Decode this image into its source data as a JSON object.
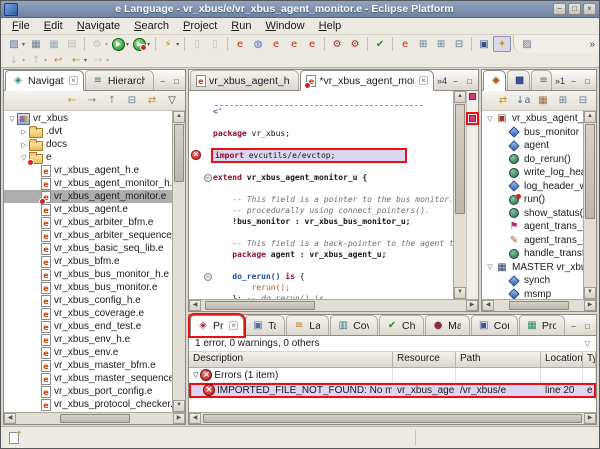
{
  "window": {
    "title": "e Language - vr_xbus/e/vr_xbus_agent_monitor.e - Eclipse Platform",
    "controls": [
      "minimize",
      "maximize",
      "close"
    ]
  },
  "menu": {
    "items": [
      "File",
      "Edit",
      "Navigate",
      "Search",
      "Project",
      "Run",
      "Window",
      "Help"
    ]
  },
  "toolbar": {
    "overflow": "»",
    "row1": [
      {
        "icon": "new-wizard",
        "dd": true
      },
      {
        "icon": "save"
      },
      {
        "icon": "save-all"
      },
      {
        "icon": "print",
        "disabled": true
      },
      {
        "sep": true
      },
      {
        "icon": "build",
        "dd": true,
        "disabled": true
      },
      {
        "icon": "run",
        "dd": true
      },
      {
        "icon": "run-external",
        "dd": true
      },
      {
        "sep": true
      },
      {
        "icon": "search-torch",
        "dd": true
      },
      {
        "sep": true
      },
      {
        "icon": "mark-occurrences",
        "disabled": true
      },
      {
        "icon": "mark-declarations",
        "disabled": true
      },
      {
        "sep": true
      },
      {
        "icon": "e-module"
      },
      {
        "icon": "e-globe"
      },
      {
        "icon": "e-file-new"
      },
      {
        "icon": "e-file-import"
      },
      {
        "icon": "e-file-export"
      },
      {
        "sep": true
      },
      {
        "icon": "compile-gears"
      },
      {
        "icon": "recompile-gears"
      },
      {
        "sep": true
      },
      {
        "icon": "e-check"
      },
      {
        "sep": true
      },
      {
        "icon": "e-doc"
      },
      {
        "icon": "expand-one"
      },
      {
        "icon": "expand-all-box"
      },
      {
        "icon": "collapse-all-box"
      },
      {
        "sep": true
      },
      {
        "icon": "cubes"
      },
      {
        "icon": "flashlight",
        "pressed": true
      }
    ],
    "row2": [
      {
        "icon": "next-annotation",
        "dd": true,
        "disabled": true
      },
      {
        "icon": "prev-annotation",
        "dd": true,
        "disabled": true
      },
      {
        "icon": "last-edit-location"
      },
      {
        "icon": "back",
        "dd": true
      },
      {
        "icon": "forward",
        "dd": true,
        "disabled": true
      }
    ],
    "perspective": {
      "icon": "perspective"
    }
  },
  "navigator": {
    "tabs": [
      {
        "label": "Navigator",
        "icon": "navigator",
        "active": true,
        "close": true
      },
      {
        "label": "Hierarchy",
        "icon": "hierarchy"
      }
    ],
    "tools": [
      "back",
      "forward",
      "up",
      "collapse-all-box",
      "link-editor",
      "view-menu"
    ],
    "tree": [
      {
        "depth": 0,
        "exp": "open",
        "icon": "project",
        "label": "vr_xbus"
      },
      {
        "depth": 1,
        "exp": "closed",
        "icon": "folder",
        "label": ".dvt"
      },
      {
        "depth": 1,
        "exp": "closed",
        "icon": "folder",
        "label": "docs"
      },
      {
        "depth": 1,
        "exp": "open",
        "icon": "folder-err",
        "label": "e"
      },
      {
        "depth": 2,
        "icon": "efile",
        "label": "vr_xbus_agent_h.e"
      },
      {
        "depth": 2,
        "icon": "efile",
        "label": "vr_xbus_agent_monitor_h.e"
      },
      {
        "depth": 2,
        "icon": "efile-err",
        "label": "vr_xbus_agent_monitor.e",
        "sel": true
      },
      {
        "depth": 2,
        "icon": "efile",
        "label": "vr_xbus_agent.e"
      },
      {
        "depth": 2,
        "icon": "efile",
        "label": "vr_xbus_arbiter_bfm.e"
      },
      {
        "depth": 2,
        "icon": "efile",
        "label": "vr_xbus_arbiter_sequence_h.e"
      },
      {
        "depth": 2,
        "icon": "efile",
        "label": "vr_xbus_basic_seq_lib.e"
      },
      {
        "depth": 2,
        "icon": "efile",
        "label": "vr_xbus_bfm.e"
      },
      {
        "depth": 2,
        "icon": "efile",
        "label": "vr_xbus_bus_monitor_h.e"
      },
      {
        "depth": 2,
        "icon": "efile",
        "label": "vr_xbus_bus_monitor.e"
      },
      {
        "depth": 2,
        "icon": "efile",
        "label": "vr_xbus_config_h.e"
      },
      {
        "depth": 2,
        "icon": "efile",
        "label": "vr_xbus_coverage.e"
      },
      {
        "depth": 2,
        "icon": "efile",
        "label": "vr_xbus_end_test.e"
      },
      {
        "depth": 2,
        "icon": "efile",
        "label": "vr_xbus_env_h.e"
      },
      {
        "depth": 2,
        "icon": "efile",
        "label": "vr_xbus_env.e"
      },
      {
        "depth": 2,
        "icon": "efile",
        "label": "vr_xbus_master_bfm.e"
      },
      {
        "depth": 2,
        "icon": "efile",
        "label": "vr_xbus_master_sequence_h.e"
      },
      {
        "depth": 2,
        "icon": "efile",
        "label": "vr_xbus_port_config.e"
      },
      {
        "depth": 2,
        "icon": "efile",
        "label": "vr_xbus_protocol_checker.e"
      }
    ]
  },
  "editor": {
    "tabs": [
      {
        "label": "vr_xbus_agent_h.e",
        "icon": "efile"
      },
      {
        "label": "*vr_xbus_agent_monit",
        "icon": "efile-err",
        "active": true,
        "close": true
      }
    ],
    "overflow": "»4",
    "code": [
      {
        "dashed": true
      },
      {
        "seg": [
          {
            "t": "<'",
            "c": "hd"
          }
        ]
      },
      {
        "seg": []
      },
      {
        "seg": [
          {
            "t": "package ",
            "c": "k"
          },
          {
            "t": "vr_xbus;",
            "c": "p"
          }
        ]
      },
      {
        "seg": []
      },
      {
        "err": true,
        "errIcon": true,
        "seg": [
          {
            "t": "import ",
            "c": "k"
          },
          {
            "t": "evcutils/e/evctop;",
            "c": "p"
          }
        ]
      },
      {
        "seg": []
      },
      {
        "fold": true,
        "seg": [
          {
            "t": "extend ",
            "c": "k"
          },
          {
            "t": "vr_xbus_agent_monitor_u {",
            "c": "b"
          }
        ]
      },
      {
        "seg": []
      },
      {
        "seg": [
          {
            "t": "    -- This field is a pointer to the bus monitor. Note",
            "c": "c"
          }
        ]
      },
      {
        "seg": [
          {
            "t": "    -- procedurally using connect_pointers().",
            "c": "c"
          }
        ]
      },
      {
        "seg": [
          {
            "t": "    !bus_monitor : vr_xbus_bus_monitor_u;",
            "c": "b"
          }
        ]
      },
      {
        "seg": []
      },
      {
        "seg": [
          {
            "t": "    -- This field is a back-pointer to the agent this mo",
            "c": "c"
          }
        ]
      },
      {
        "seg": [
          {
            "t": "    ",
            "c": "p"
          },
          {
            "t": "package ",
            "c": "k"
          },
          {
            "t": "agent : vr_xbus_agent_u;",
            "c": "b"
          }
        ]
      },
      {
        "seg": []
      },
      {
        "fold": true,
        "seg": [
          {
            "t": "    ",
            "c": "p"
          },
          {
            "t": "do_rerun()",
            "c": "m"
          },
          {
            "t": " ",
            "c": "p"
          },
          {
            "t": "is",
            "c": "k"
          },
          {
            "t": " {",
            "c": "p"
          }
        ]
      },
      {
        "seg": [
          {
            "t": "        ",
            "c": "p"
          },
          {
            "t": "rerun();",
            "c": "f"
          }
        ]
      },
      {
        "seg": [
          {
            "t": "    }; ",
            "c": "p"
          },
          {
            "t": "-- do_rerun() is",
            "c": "c"
          }
        ]
      }
    ]
  },
  "outline": {
    "tabs": [
      {
        "label": "L",
        "icon": "outline-l",
        "active": true
      },
      {
        "label": "T",
        "icon": "outline-t"
      },
      {
        "label": "I",
        "icon": "outline-i"
      }
    ],
    "overflow": "»1",
    "tools": [
      "link-editor",
      "sort-az",
      "filter-grid",
      "expand-all-box",
      "collapse-all-box"
    ],
    "tree": [
      {
        "depth": 0,
        "exp": "open",
        "icon": "module",
        "label": "vr_xbus_agent_mo"
      },
      {
        "depth": 1,
        "icon": "field",
        "label": "bus_monitor"
      },
      {
        "depth": 1,
        "icon": "field",
        "label": "agent"
      },
      {
        "depth": 1,
        "icon": "method",
        "label": "do_rerun()"
      },
      {
        "depth": 1,
        "icon": "method",
        "label": "write_log_heade"
      },
      {
        "depth": 1,
        "icon": "field",
        "label": "log_header_writt"
      },
      {
        "depth": 1,
        "icon": "method-o",
        "label": "run()"
      },
      {
        "depth": 1,
        "icon": "method",
        "label": "show_status()"
      },
      {
        "depth": 1,
        "icon": "event",
        "label": "agent_trans_end"
      },
      {
        "depth": 1,
        "icon": "on-handler",
        "label": "agent_trans_end"
      },
      {
        "depth": 1,
        "icon": "method",
        "label": "handle_transfer_"
      },
      {
        "depth": 0,
        "exp": "open",
        "icon": "struct",
        "label": "MASTER vr_xbus_a"
      },
      {
        "depth": 1,
        "icon": "field",
        "label": "synch"
      },
      {
        "depth": 1,
        "icon": "field",
        "label": "msmp"
      }
    ]
  },
  "problems": {
    "tabs": [
      {
        "label": "Problem",
        "icon": "problem",
        "active": true,
        "close": true,
        "redbox": true
      },
      {
        "label": "Tasks",
        "icon": "tasks"
      },
      {
        "label": "Layers",
        "icon": "layers"
      },
      {
        "label": "Coverag",
        "icon": "coverage"
      },
      {
        "label": "Checks",
        "icon": "checks"
      },
      {
        "label": "Macros",
        "icon": "macros"
      },
      {
        "label": "Console",
        "icon": "console"
      },
      {
        "label": "Progres",
        "icon": "progress"
      }
    ],
    "summary": "1 error, 0 warnings, 0 others",
    "columns": [
      "Description",
      "Resource",
      "Path",
      "Location",
      "Type"
    ],
    "rows": [
      {
        "kind": "group",
        "exp": "open",
        "description": "Errors (1 item)"
      },
      {
        "kind": "error",
        "sel": true,
        "redbox": true,
        "description": "IMPORTED_FILE_NOT_FOUND: No match for i",
        "resource": "vr_xbus_agent_",
        "path": "/vr_xbus/e",
        "location": "line 20",
        "typecol": "e Sy"
      }
    ]
  },
  "colors": {
    "titlebar": "#7e90ad",
    "chrome": "#edeae4",
    "selection_unfocused": "#aeaeae",
    "error_line_highlight": "#dbd6f3",
    "annotation_red": "#ea1010",
    "keyword": "#8a1028",
    "comment": "#6e6e6e",
    "error_marker": "#cf3d7e"
  }
}
